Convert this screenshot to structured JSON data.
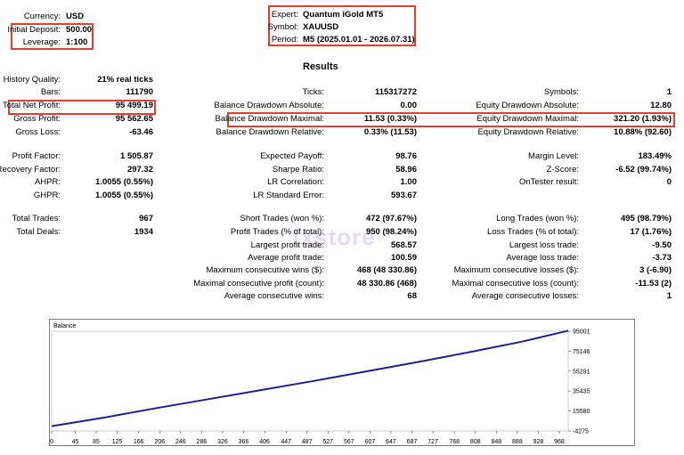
{
  "settings": {
    "currency_label": "Currency:",
    "currency_value": "USD",
    "deposit_label": "Initial Deposit:",
    "deposit_value": "500.00",
    "leverage_label": "Leverage:",
    "leverage_value": "1:100",
    "expert_label": "Expert:",
    "expert_value": "Quantum iGold MT5",
    "symbol_label": "Symbol:",
    "symbol_value": "XAUUSD",
    "period_label": "Period:",
    "period_value": "M5 (2025.01.01 - 2026.07.31)"
  },
  "results": {
    "title": "Results",
    "col1": [
      {
        "label": "History Quality:",
        "value": "21% real ticks"
      },
      {
        "label": "Bars:",
        "value": "111790"
      },
      {
        "label": "Total Net Profit:",
        "value": "95 499.19"
      },
      {
        "label": "Gross Profit:",
        "value": "95 562.65"
      },
      {
        "label": "Gross Loss:",
        "value": "-63.46"
      },
      {
        "label": "Profit Factor:",
        "value": "1 505.87"
      },
      {
        "label": "Recovery Factor:",
        "value": "297.32"
      },
      {
        "label": "AHPR:",
        "value": "1.0055 (0.55%)"
      },
      {
        "label": "GHPR:",
        "value": "1.0055 (0.55%)"
      },
      {
        "label": "Total Trades:",
        "value": "967"
      },
      {
        "label": "Total Deals:",
        "value": "1934"
      }
    ],
    "col2": [
      {
        "label": "Ticks:",
        "value": "115317272"
      },
      {
        "label": "Balance Drawdown Absolute:",
        "value": "0.00"
      },
      {
        "label": "Balance Drawdown Maximal:",
        "value": "11.53 (0.33%)"
      },
      {
        "label": "Balance Drawdown Relative:",
        "value": "0.33% (11.53)"
      },
      {
        "label": "Expected Payoff:",
        "value": "98.76"
      },
      {
        "label": "Sharpe Ratio:",
        "value": "58.96"
      },
      {
        "label": "LR Correlation:",
        "value": "1.00"
      },
      {
        "label": "LR Standard Error:",
        "value": "593.67"
      },
      {
        "label": "Short Trades (won %):",
        "value": "472 (97.67%)"
      },
      {
        "label": "Profit Trades (% of total):",
        "value": "950 (98.24%)"
      },
      {
        "label": "Largest profit trade:",
        "value": "568.57"
      },
      {
        "label": "Average profit trade:",
        "value": "100.59"
      },
      {
        "label": "Maximum consecutive wins ($):",
        "value": "468 (48 330.86)"
      },
      {
        "label": "Maximal consecutive profit (count):",
        "value": "48 330.86 (468)"
      },
      {
        "label": "Average consecutive wins:",
        "value": "68"
      }
    ],
    "col3": [
      {
        "label": "Symbols:",
        "value": "1"
      },
      {
        "label": "Equity Drawdown Absolute:",
        "value": "12.80"
      },
      {
        "label": "Equity Drawdown Maximal:",
        "value": "321.20 (1.93%)"
      },
      {
        "label": "Equity Drawdown Relative:",
        "value": "10.88% (92.60)"
      },
      {
        "label": "Margin Level:",
        "value": "183.49%"
      },
      {
        "label": "Z-Score:",
        "value": "-6.52 (99.74%)"
      },
      {
        "label": "OnTester result:",
        "value": "0"
      },
      {
        "label": "Long Trades (won %):",
        "value": "495 (98.79%)"
      },
      {
        "label": "Loss Trades (% of total):",
        "value": "17 (1.76%)"
      },
      {
        "label": "Largest loss trade:",
        "value": "-9.50"
      },
      {
        "label": "Average loss trade:",
        "value": "-3.73"
      },
      {
        "label": "Maximum consecutive losses ($):",
        "value": "3 (-6.90)"
      },
      {
        "label": "Maximal consecutive loss (count):",
        "value": "-11.53 (2)"
      },
      {
        "label": "Average consecutive losses:",
        "value": "1"
      }
    ]
  },
  "watermark": "fxstore",
  "chart_data": {
    "type": "line",
    "title": "Balance",
    "xlabel": "",
    "ylabel": "",
    "x_ticks": [
      0,
      45,
      85,
      125,
      166,
      206,
      246,
      286,
      326,
      366,
      406,
      447,
      487,
      527,
      567,
      607,
      647,
      687,
      727,
      768,
      808,
      848,
      888,
      928,
      968
    ],
    "y_ticks": [
      95001,
      75146,
      55291,
      35435,
      15580,
      -4275
    ],
    "xlim": [
      0,
      985
    ],
    "ylim": [
      -4275,
      95001
    ],
    "series": [
      {
        "values": [
          [
            0,
            500
          ],
          [
            100,
            9000
          ],
          [
            200,
            18500
          ],
          [
            300,
            27500
          ],
          [
            400,
            36500
          ],
          [
            500,
            45500
          ],
          [
            600,
            55000
          ],
          [
            700,
            64500
          ],
          [
            800,
            74500
          ],
          [
            900,
            85000
          ],
          [
            985,
            95500
          ]
        ]
      }
    ],
    "line_color": "#1f1f8f"
  }
}
